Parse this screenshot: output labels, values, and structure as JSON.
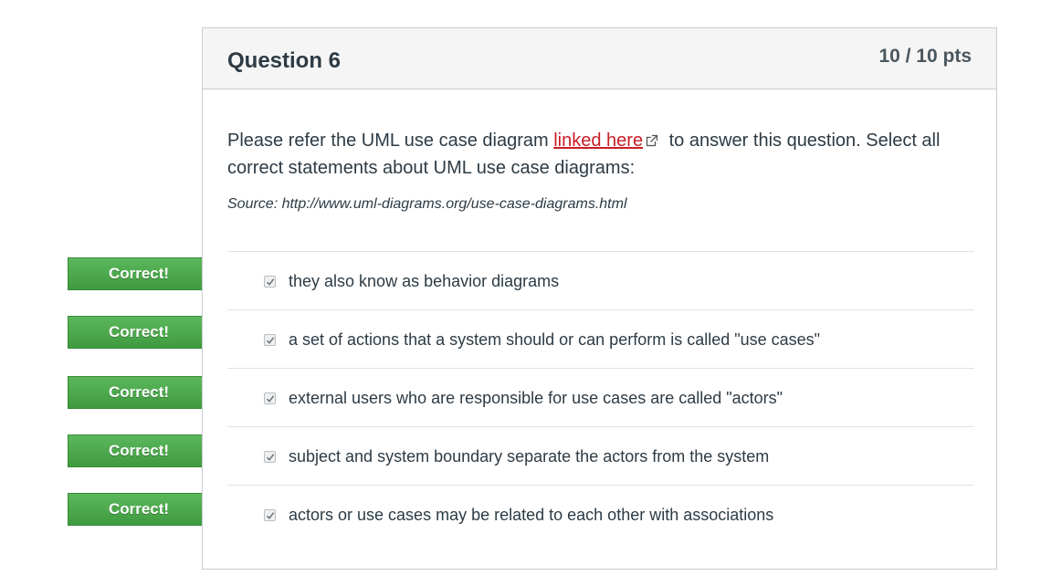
{
  "question": {
    "title": "Question 6",
    "points": "10 / 10 pts",
    "text_before_link": "Please refer the UML use case diagram ",
    "link_text": "linked here",
    "text_after_link": " to answer this question. Select all correct statements about UML use case diagrams:",
    "source": "Source: http://www.uml-diagrams.org/use-case-diagrams.html"
  },
  "answers": [
    {
      "text": "they also know as behavior diagrams",
      "checked": true,
      "flag": "Correct!"
    },
    {
      "text": "a set of actions that a system should or can perform is called \"use cases\"",
      "checked": true,
      "flag": "Correct!"
    },
    {
      "text": "external users who are responsible for use cases are called \"actors\"",
      "checked": true,
      "flag": "Correct!"
    },
    {
      "text": "subject and system boundary separate the actors from the system",
      "checked": true,
      "flag": "Correct!"
    },
    {
      "text": "actors or use cases may be related to each other with associations",
      "checked": true,
      "flag": "Correct!"
    }
  ],
  "colors": {
    "correct_flag": "#4caf50",
    "link": "#c91d25"
  },
  "icons": {
    "link": "external-link-icon",
    "checkbox": "checkmark-icon"
  }
}
